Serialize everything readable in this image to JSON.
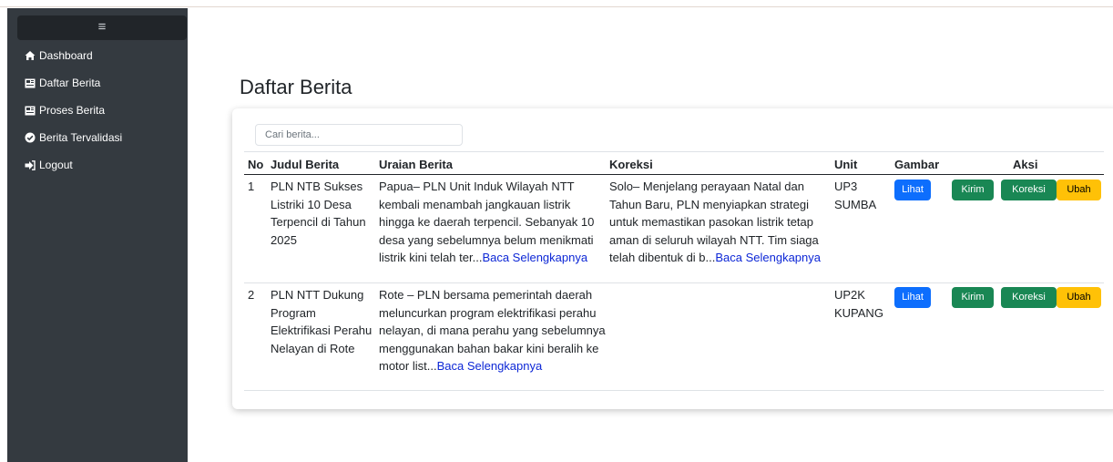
{
  "colors": {
    "sidebar_bg": "#343a40",
    "primary": "#0d6efd",
    "success": "#198754",
    "warning": "#ffc107",
    "link": "#0d27d6"
  },
  "sidebar": {
    "toggle_label": "≡",
    "items": [
      {
        "label": "Dashboard",
        "icon": "home-icon"
      },
      {
        "label": "Daftar Berita",
        "icon": "newspaper-icon"
      },
      {
        "label": "Proses Berita",
        "icon": "newspaper-icon"
      },
      {
        "label": "Berita Tervalidasi",
        "icon": "check-circle-icon"
      },
      {
        "label": "Logout",
        "icon": "logout-icon"
      }
    ]
  },
  "main": {
    "title": "Daftar Berita",
    "search": {
      "placeholder": "Cari berita...",
      "value": ""
    },
    "table": {
      "headers": [
        "No",
        "Judul Berita",
        "Uraian Berita",
        "Koreksi",
        "Unit",
        "Gambar",
        "Aksi"
      ],
      "rows": [
        {
          "no": "1",
          "judul": "PLN NTB Sukses Listriki 10 Desa Terpencil di Tahun 2025",
          "uraian": "Papua– PLN Unit Induk Wilayah NTT kembali menambah jangkauan listrik hingga ke daerah terpencil. Sebanyak 10 desa yang sebelumnya belum menikmati listrik kini telah ter...",
          "uraian_link": "Baca Selengkapnya",
          "koreksi": "Solo– Menjelang perayaan Natal dan Tahun Baru, PLN menyiapkan strategi untuk memastikan pasokan listrik tetap aman di seluruh wilayah NTT. Tim siaga telah dibentuk di b...",
          "koreksi_link": "Baca Selengkapnya",
          "unit": "UP3 SUMBA",
          "gambar_button": "Lihat",
          "aksi_buttons": [
            "Kirim",
            "Koreksi",
            "Ubah"
          ]
        },
        {
          "no": "2",
          "judul": "PLN NTT Dukung Program Elektrifikasi Perahu Nelayan di Rote",
          "uraian": "Rote – PLN bersama pemerintah daerah meluncurkan program elektrifikasi perahu nelayan, di mana perahu yang sebelumnya menggunakan bahan bakar kini beralih ke motor list...",
          "uraian_link": "Baca Selengkapnya",
          "koreksi": "",
          "koreksi_link": "",
          "unit": "UP2K KUPANG",
          "gambar_button": "Lihat",
          "aksi_buttons": [
            "Kirim",
            "Koreksi",
            "Ubah"
          ]
        }
      ]
    }
  }
}
